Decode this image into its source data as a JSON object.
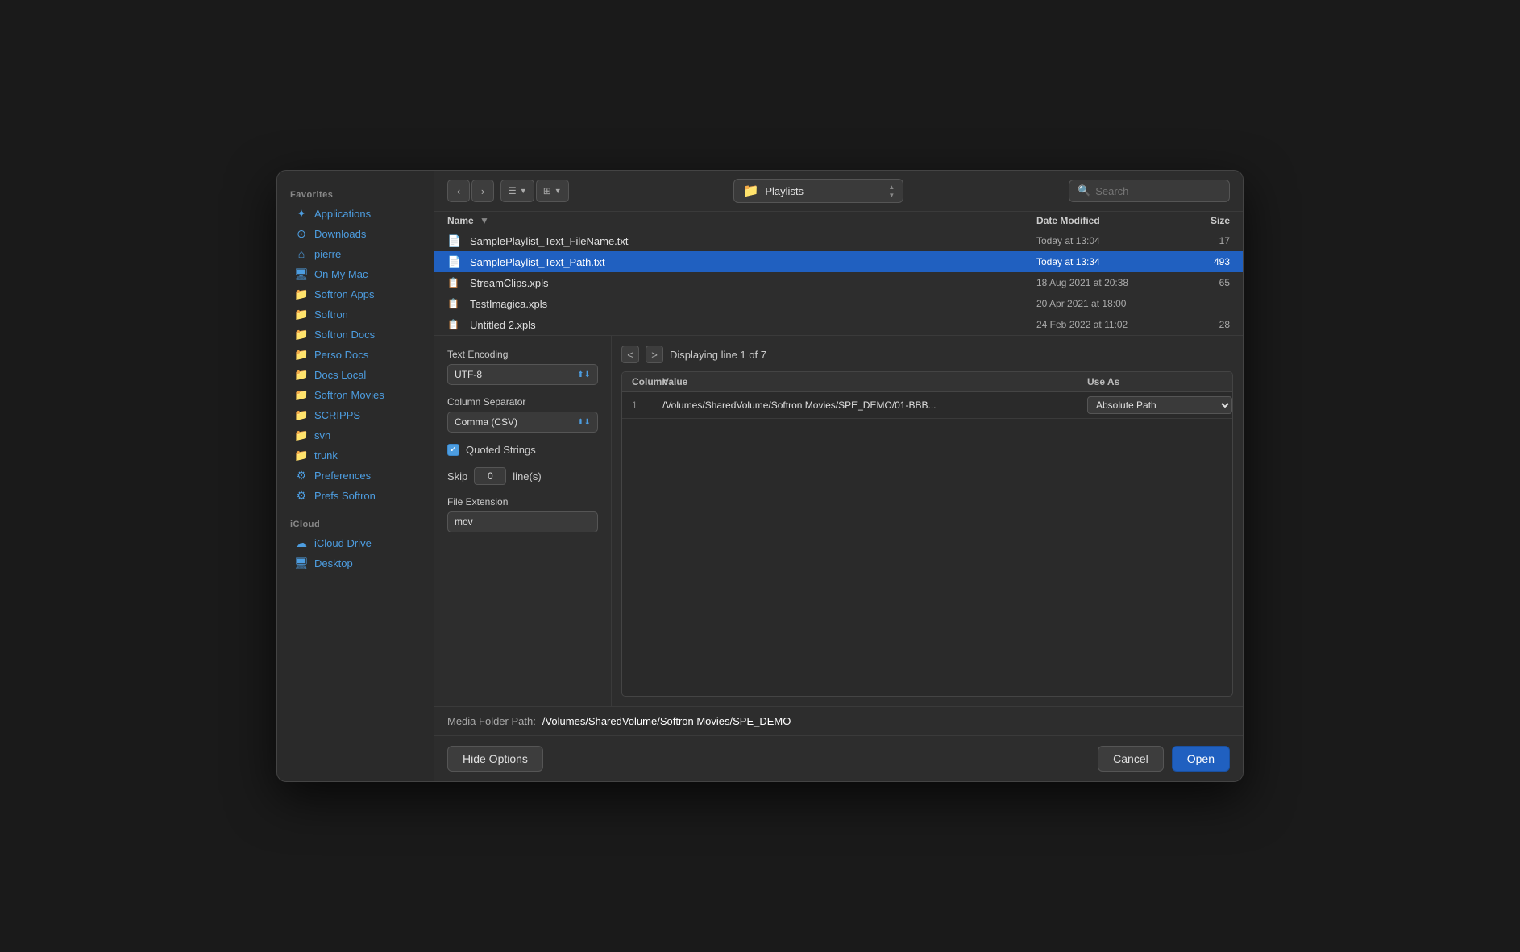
{
  "sidebar": {
    "favorites_label": "Favorites",
    "icloud_label": "iCloud",
    "items": [
      {
        "id": "applications",
        "label": "Applications",
        "icon": "✦"
      },
      {
        "id": "downloads",
        "label": "Downloads",
        "icon": "⊙"
      },
      {
        "id": "pierre",
        "label": "pierre",
        "icon": "🏠"
      },
      {
        "id": "on-my-mac",
        "label": "On My Mac",
        "icon": "🖥"
      },
      {
        "id": "softron-apps",
        "label": "Softron Apps",
        "icon": "📁"
      },
      {
        "id": "softron",
        "label": "Softron",
        "icon": "📁"
      },
      {
        "id": "softron-docs",
        "label": "Softron Docs",
        "icon": "📁"
      },
      {
        "id": "perso-docs",
        "label": "Perso Docs",
        "icon": "📁"
      },
      {
        "id": "docs-local",
        "label": "Docs Local",
        "icon": "📁"
      },
      {
        "id": "softron-movies",
        "label": "Softron Movies",
        "icon": "📁"
      },
      {
        "id": "scripps",
        "label": "SCRIPPS",
        "icon": "📁"
      },
      {
        "id": "svn",
        "label": "svn",
        "icon": "📁"
      },
      {
        "id": "trunk",
        "label": "trunk",
        "icon": "📁"
      },
      {
        "id": "preferences",
        "label": "Preferences",
        "icon": "⚙"
      },
      {
        "id": "prefs-softron",
        "label": "Prefs Softron",
        "icon": "⚙"
      }
    ],
    "icloud_items": [
      {
        "id": "icloud-drive",
        "label": "iCloud Drive",
        "icon": "☁"
      },
      {
        "id": "desktop",
        "label": "Desktop",
        "icon": "🖥"
      }
    ]
  },
  "toolbar": {
    "back_btn": "‹",
    "forward_btn": "›",
    "list_view_btn": "☰",
    "grid_view_btn": "⊞",
    "location_icon": "📁",
    "location_text": "Playlists",
    "search_placeholder": "Search"
  },
  "file_list": {
    "col_name": "Name",
    "col_date": "Date Modified",
    "col_size": "Size",
    "files": [
      {
        "icon": "📄",
        "name": "SamplePlaylist_Text_FileName.txt",
        "date": "Today at 13:04",
        "size": "17",
        "selected": false
      },
      {
        "icon": "📄",
        "name": "SamplePlaylist_Text_Path.txt",
        "date": "Today at 13:34",
        "size": "493",
        "selected": true
      },
      {
        "icon": "📋",
        "name": "StreamClips.xpls",
        "date": "18 Aug 2021 at 20:38",
        "size": "65",
        "selected": false
      },
      {
        "icon": "📋",
        "name": "TestImagica.xpls",
        "date": "20 Apr 2021 at 18:00",
        "size": "",
        "selected": false
      },
      {
        "icon": "📋",
        "name": "Untitled 2.xpls",
        "date": "24 Feb 2022 at 11:02",
        "size": "28",
        "selected": false
      }
    ]
  },
  "options": {
    "text_encoding_label": "Text Encoding",
    "text_encoding_value": "UTF-8",
    "column_separator_label": "Column Separator",
    "column_separator_value": "Comma (CSV)",
    "quoted_strings_label": "Quoted Strings",
    "quoted_strings_checked": true,
    "skip_label": "Skip",
    "skip_value": "0",
    "skip_unit": "line(s)",
    "file_extension_label": "File Extension",
    "file_extension_value": "mov"
  },
  "preview": {
    "nav_prev": "<",
    "nav_next": ">",
    "display_info": "Displaying line 1 of 7",
    "col_column": "Column",
    "col_value": "Value",
    "col_use_as": "Use As",
    "rows": [
      {
        "num": "1",
        "value": "/Volumes/SharedVolume/Softron Movies/SPE_DEMO/01-BBB...",
        "use_as": "Absolute Path"
      }
    ]
  },
  "media_folder": {
    "label": "Media Folder Path:",
    "value": "/Volumes/SharedVolume/Softron Movies/SPE_DEMO"
  },
  "bottom": {
    "hide_options_btn": "Hide Options",
    "cancel_btn": "Cancel",
    "open_btn": "Open"
  }
}
